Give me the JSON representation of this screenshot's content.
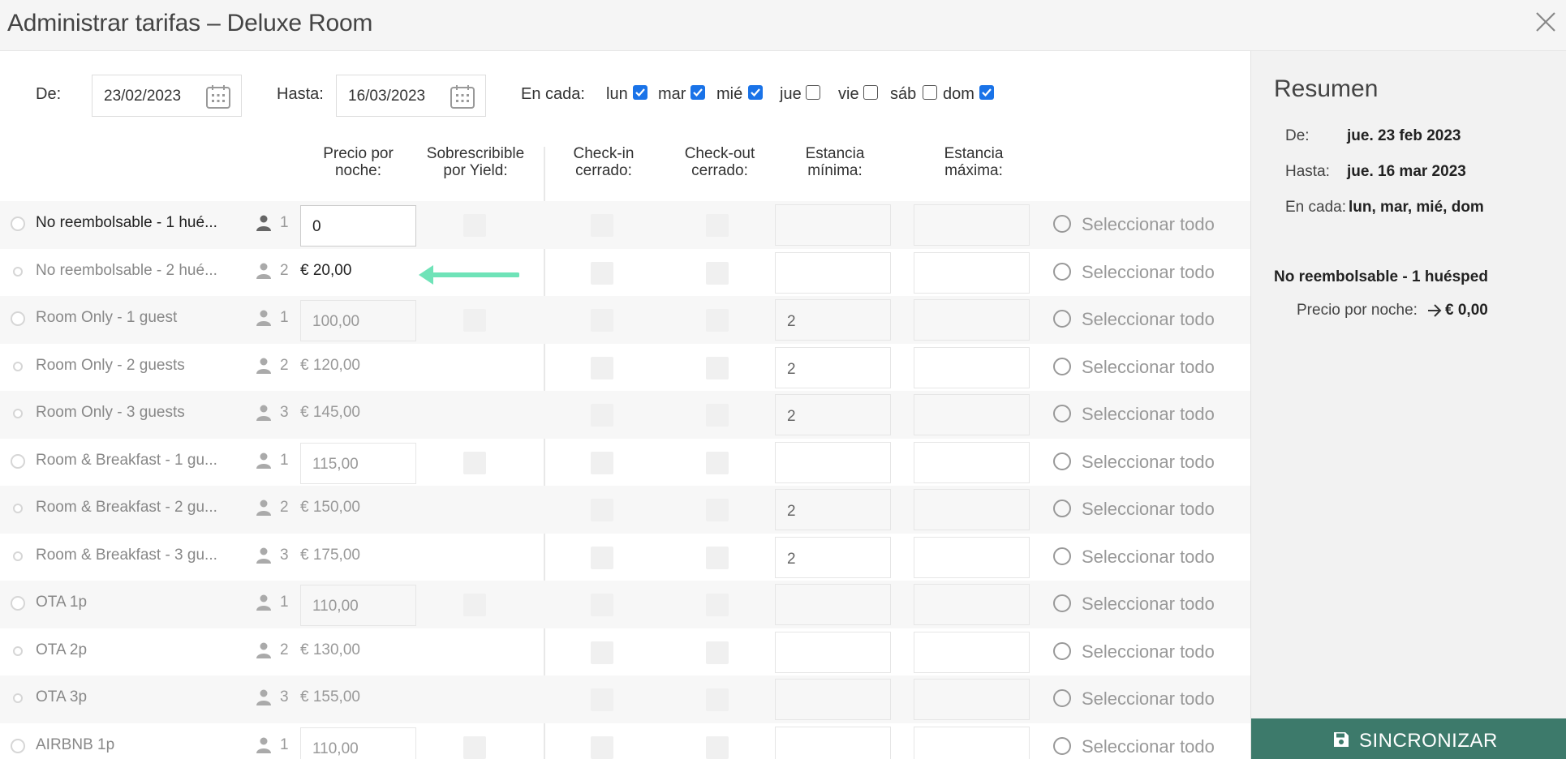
{
  "window": {
    "title": "Administrar tarifas  –  Deluxe Room"
  },
  "filters": {
    "from_label": "De:",
    "from_value": "23/02/2023",
    "to_label": "Hasta:",
    "to_value": "16/03/2023",
    "each_label": "En cada:",
    "days": [
      {
        "label": "lun",
        "checked": true
      },
      {
        "label": "mar",
        "checked": true
      },
      {
        "label": "mié",
        "checked": true
      },
      {
        "label": "jue",
        "checked": false
      },
      {
        "label": "vie",
        "checked": false
      },
      {
        "label": "sáb",
        "checked": false
      },
      {
        "label": "dom",
        "checked": true
      }
    ]
  },
  "columns": {
    "price_1": "Precio por",
    "price_2": "noche:",
    "yield_1": "Sobrescribible",
    "yield_2": "por Yield:",
    "checkin_1": "Check-in",
    "checkin_2": "cerrado:",
    "checkout_1": "Check-out",
    "checkout_2": "cerrado:",
    "min_1": "Estancia",
    "min_2": "mínima:",
    "max_1": "Estancia",
    "max_2": "máxima:"
  },
  "select_all_label": "Seleccionar todo",
  "rates": [
    {
      "name": "No reembolsable - 1 hué...",
      "persons": "1",
      "price": "0",
      "min_stay": ""
    },
    {
      "name": "No reembolsable - 2 hué...",
      "persons": "2",
      "price": "€ 20,00",
      "min_stay": ""
    },
    {
      "name": "Room Only - 1 guest",
      "persons": "1",
      "price": "100,00",
      "min_stay": "2"
    },
    {
      "name": "Room Only - 2 guests",
      "persons": "2",
      "price": "€ 120,00",
      "min_stay": "2"
    },
    {
      "name": "Room Only - 3 guests",
      "persons": "3",
      "price": "€ 145,00",
      "min_stay": "2"
    },
    {
      "name": "Room & Breakfast - 1 gu...",
      "persons": "1",
      "price": "115,00",
      "min_stay": ""
    },
    {
      "name": "Room & Breakfast - 2 gu...",
      "persons": "2",
      "price": "€ 150,00",
      "min_stay": "2"
    },
    {
      "name": "Room & Breakfast - 3 gu...",
      "persons": "3",
      "price": "€ 175,00",
      "min_stay": "2"
    },
    {
      "name": "OTA 1p",
      "persons": "1",
      "price": "110,00",
      "min_stay": ""
    },
    {
      "name": "OTA 2p",
      "persons": "2",
      "price": "€ 130,00",
      "min_stay": ""
    },
    {
      "name": "OTA 3p",
      "persons": "3",
      "price": "€ 155,00",
      "min_stay": ""
    },
    {
      "name": "AIRBNB 1p",
      "persons": "1",
      "price": "110,00",
      "min_stay": ""
    }
  ],
  "summary": {
    "title": "Resumen",
    "from_label": "De:",
    "from_value": "jue. 23 feb 2023",
    "to_label": "Hasta:",
    "to_value": "jue. 16 mar 2023",
    "each_label": "En cada:",
    "each_value": "lun, mar, mié, dom",
    "rate_name": "No reembolsable - 1 huésped",
    "price_label": "Precio por noche:",
    "price_value": "€ 0,00"
  },
  "sync_button": {
    "label": "SINCRONIZAR"
  },
  "colors": {
    "accent": "#3d7a6b",
    "arrow": "#6fe3b8",
    "checkbox": "#1a73e8"
  }
}
